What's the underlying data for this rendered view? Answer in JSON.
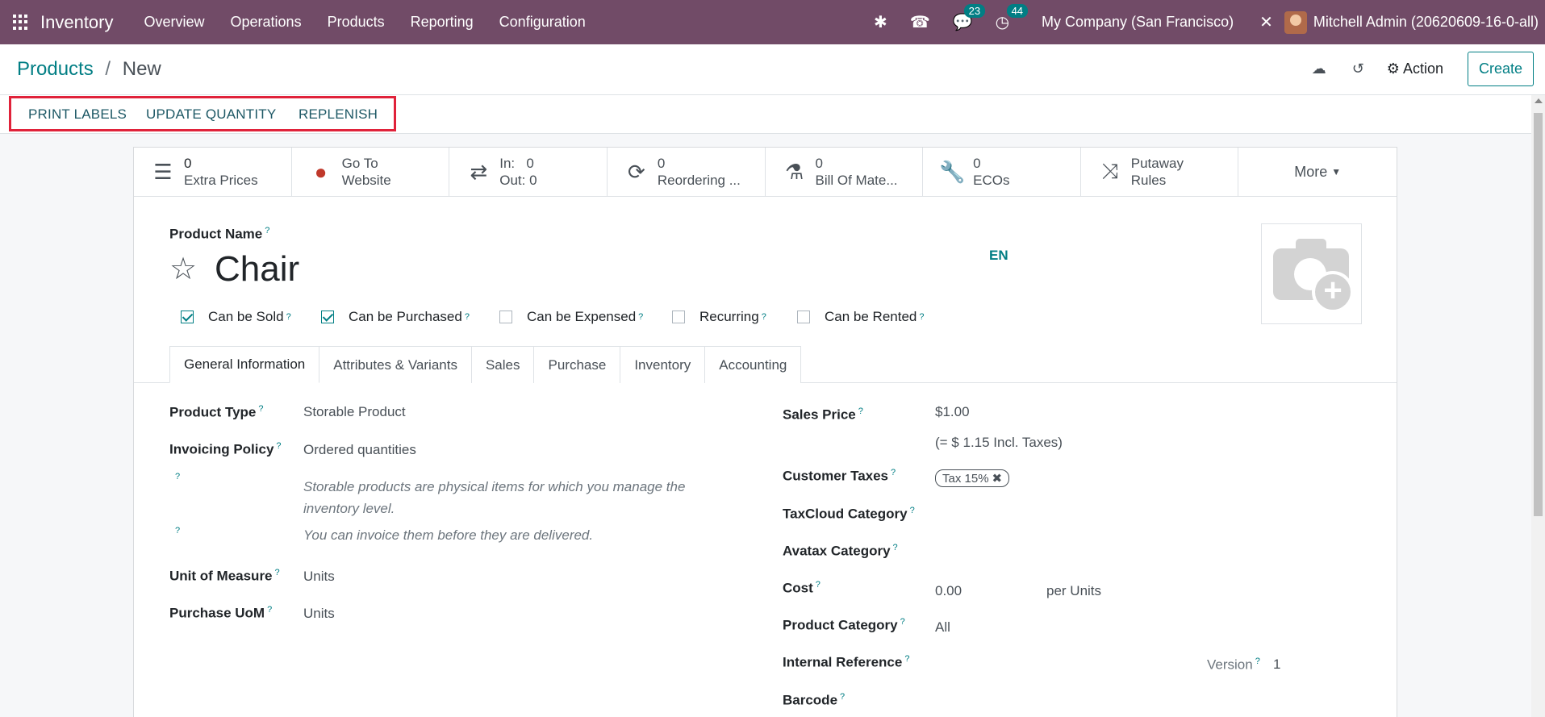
{
  "navbar": {
    "app_name": "Inventory",
    "menu": [
      "Overview",
      "Operations",
      "Products",
      "Reporting",
      "Configuration"
    ],
    "messages_count": "23",
    "activities_count": "44",
    "company": "My Company (San Francisco)",
    "user": "Mitchell Admin (20620609-16-0-all)",
    "bg_color": "#714b67"
  },
  "breadcrumb": {
    "parent": "Products",
    "separator": "/",
    "current": "New"
  },
  "control": {
    "action_label": "Action",
    "create_label": "Create"
  },
  "statusbar": {
    "buttons": [
      "PRINT LABELS",
      "UPDATE QUANTITY",
      "REPLENISH"
    ]
  },
  "smart_buttons": [
    {
      "num": "0",
      "label": "Extra Prices",
      "icon": "list-icon"
    },
    {
      "num": "Go To",
      "label": "Website",
      "icon": "globe-icon"
    },
    {
      "num": "In:   0",
      "label": "Out: 0",
      "icon": "transfer-icon"
    },
    {
      "num": "0",
      "label": "Reordering ...",
      "icon": "refresh-icon"
    },
    {
      "num": "0",
      "label": "Bill Of Mate...",
      "icon": "flask-icon"
    },
    {
      "num": "0",
      "label": "ECOs",
      "icon": "wrench-icon"
    },
    {
      "num": "Putaway",
      "label": "Rules",
      "icon": "random-icon"
    },
    {
      "more": "More"
    }
  ],
  "form": {
    "name_label": "Product Name",
    "help": "?",
    "product_name": "Chair",
    "lang": "EN",
    "checkboxes": [
      {
        "label": "Can be Sold",
        "checked": true
      },
      {
        "label": "Can be Purchased",
        "checked": true
      },
      {
        "label": "Can be Expensed",
        "checked": false
      },
      {
        "label": "Recurring",
        "checked": false
      },
      {
        "label": "Can be Rented",
        "checked": false
      }
    ],
    "tabs": [
      "General Information",
      "Attributes & Variants",
      "Sales",
      "Purchase",
      "Inventory",
      "Accounting"
    ],
    "left": {
      "product_type_label": "Product Type",
      "product_type": "Storable Product",
      "invoicing_label": "Invoicing Policy",
      "invoicing": "Ordered quantities",
      "help1": "Storable products are physical items for which you manage the inventory level.",
      "help2": "You can invoice them before they are delivered.",
      "uom_label": "Unit of Measure",
      "uom": "Units",
      "po_uom_label": "Purchase UoM",
      "po_uom": "Units"
    },
    "right": {
      "sales_price_label": "Sales Price",
      "sales_price": "$1.00",
      "incl_taxes": "(= $ 1.15 Incl. Taxes)",
      "customer_taxes_label": "Customer Taxes",
      "tax_tag": "Tax 15%",
      "taxcloud_label": "TaxCloud Category",
      "avatax_label": "Avatax Category",
      "cost_label": "Cost",
      "cost": "0.00",
      "per_units": "per Units",
      "category_label": "Product Category",
      "category": "All",
      "internal_ref_label": "Internal Reference",
      "version_label": "Version",
      "version": "1",
      "barcode_label": "Barcode"
    }
  }
}
